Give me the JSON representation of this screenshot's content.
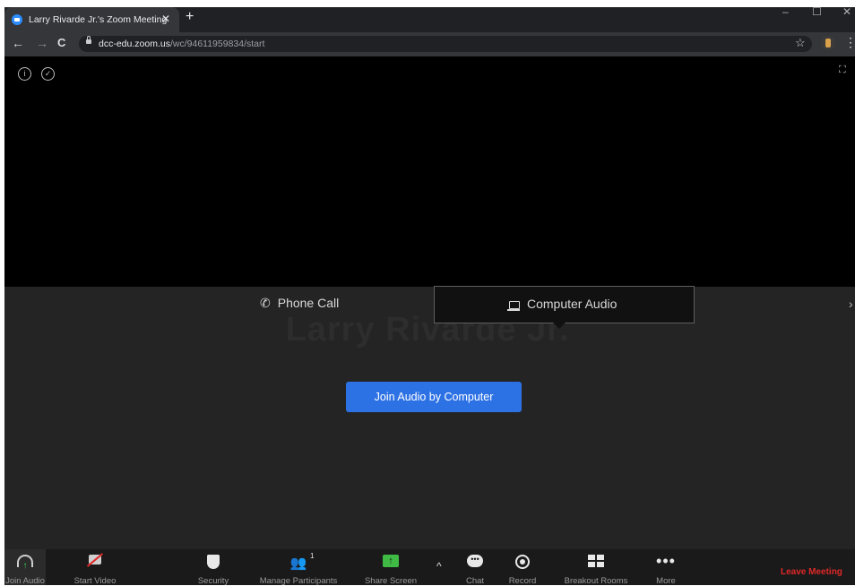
{
  "browser": {
    "tab_title": "Larry Rivarde Jr.'s Zoom Meeting",
    "tab_close": "✕",
    "new_tab": "+",
    "url_domain": "dcc-edu.zoom.us",
    "url_path": "/wc/94611959834/start",
    "window_controls": [
      "–",
      "☐",
      "✕"
    ],
    "nav": {
      "back": "←",
      "forward": "→",
      "reload": "C"
    },
    "star": "☆",
    "menu": "⋮"
  },
  "meeting": {
    "participant_name": "Larry Rivarde Jr.",
    "audio_tabs": {
      "phone": "Phone Call",
      "computer": "Computer Audio"
    },
    "join_button": "Join Audio by Computer"
  },
  "toolbar": {
    "join_audio": "Join Audio",
    "start_video": "Start Video",
    "security": "Security",
    "manage_participants": "Manage Participants",
    "participant_count": "1",
    "share_screen": "Share Screen",
    "chat": "Chat",
    "record": "Record",
    "breakout_rooms": "Breakout Rooms",
    "more": "More",
    "leave": "Leave Meeting"
  },
  "colors": {
    "accent_blue": "#2d72e5",
    "leave_red": "#e02828",
    "share_green": "#3fbb45"
  }
}
